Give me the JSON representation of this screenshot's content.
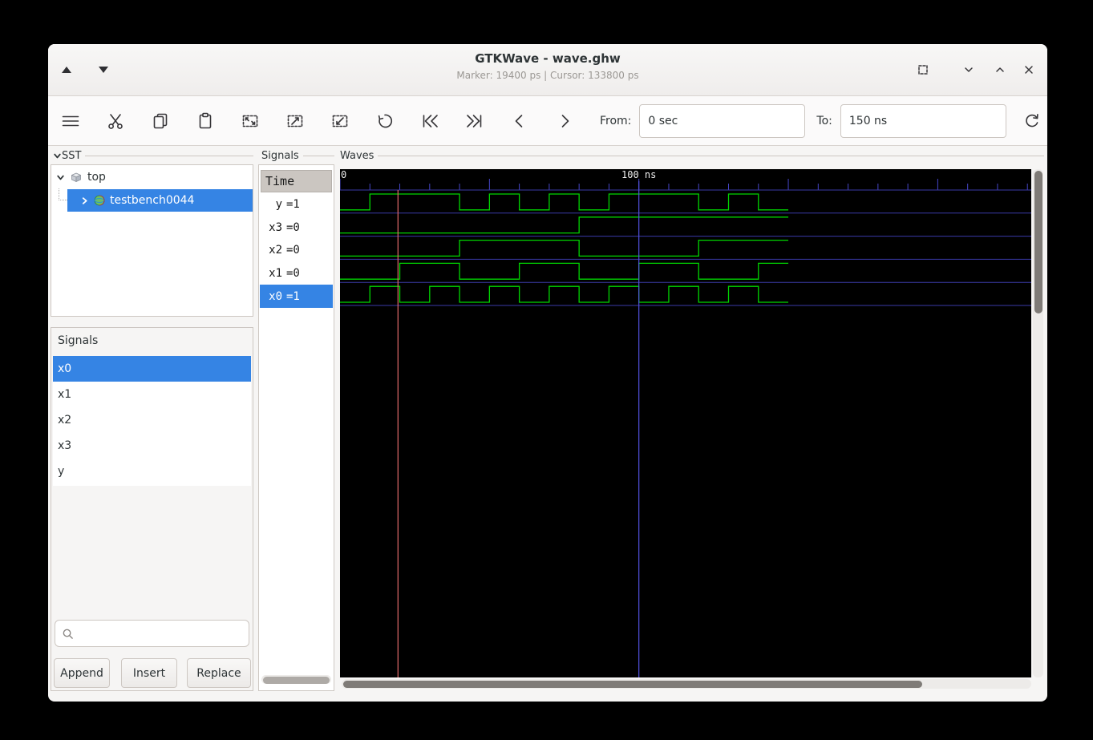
{
  "window": {
    "title": "GTKWave - wave.ghw",
    "subtitle": "Marker: 19400 ps | Cursor: 133800 ps",
    "marker": "19400 ps",
    "cursor": "133800 ps"
  },
  "toolbar": {
    "from_label": "From:",
    "from_value": "0 sec",
    "to_label": "To:",
    "to_value": "150 ns",
    "icon_names": [
      "menu-icon",
      "cut-icon",
      "copy-icon",
      "paste-icon",
      "zoom-fit-icon",
      "zoom-in-icon",
      "zoom-out-icon",
      "undo-icon",
      "to-start-icon",
      "to-end-icon",
      "left-icon",
      "right-icon",
      "reload-icon"
    ]
  },
  "sst": {
    "frame_label": "SST",
    "tree": [
      {
        "label": "top",
        "expanded": true
      },
      {
        "label": "testbench0044",
        "selected": true
      }
    ]
  },
  "signal_list": {
    "frame_label": "Signals",
    "items": [
      {
        "label": "x0",
        "selected": true
      },
      {
        "label": "x1"
      },
      {
        "label": "x2"
      },
      {
        "label": "x3"
      },
      {
        "label": "y"
      }
    ],
    "search_value": "",
    "buttons": {
      "append": "Append",
      "insert": "Insert",
      "replace": "Replace"
    }
  },
  "signals_panel": {
    "frame_label": "Signals",
    "time_header": "Time",
    "rows": [
      {
        "name": "y",
        "value": "=1"
      },
      {
        "name": "x3",
        "value": "=0"
      },
      {
        "name": "x2",
        "value": "=0"
      },
      {
        "name": "x1",
        "value": "=0"
      },
      {
        "name": "x0",
        "value": "=1",
        "selected": true
      }
    ]
  },
  "waves": {
    "frame_label": "Waves"
  },
  "chart_data": {
    "type": "digital-waveform",
    "time_unit": "ns",
    "t_start": 0,
    "t_end": 150,
    "tick_interval_ns": 10,
    "timeline_labels": [
      {
        "t": 0,
        "label": "0"
      },
      {
        "t": 100,
        "label": "100 ns"
      }
    ],
    "marker_ns": 19.4,
    "grid_line_ns": 100,
    "signals": [
      {
        "name": "y",
        "transitions": [
          [
            0,
            0
          ],
          [
            10,
            1
          ],
          [
            40,
            0
          ],
          [
            50,
            1
          ],
          [
            60,
            0
          ],
          [
            70,
            1
          ],
          [
            80,
            0
          ],
          [
            90,
            1
          ],
          [
            120,
            0
          ],
          [
            130,
            1
          ],
          [
            140,
            0
          ]
        ]
      },
      {
        "name": "x3",
        "transitions": [
          [
            0,
            0
          ],
          [
            80,
            1
          ]
        ]
      },
      {
        "name": "x2",
        "transitions": [
          [
            0,
            0
          ],
          [
            40,
            1
          ],
          [
            80,
            0
          ],
          [
            120,
            1
          ]
        ]
      },
      {
        "name": "x1",
        "transitions": [
          [
            0,
            0
          ],
          [
            20,
            1
          ],
          [
            40,
            0
          ],
          [
            60,
            1
          ],
          [
            80,
            0
          ],
          [
            100,
            1
          ],
          [
            120,
            0
          ],
          [
            140,
            1
          ]
        ]
      },
      {
        "name": "x0",
        "transitions": [
          [
            0,
            0
          ],
          [
            10,
            1
          ],
          [
            20,
            0
          ],
          [
            30,
            1
          ],
          [
            40,
            0
          ],
          [
            50,
            1
          ],
          [
            60,
            0
          ],
          [
            70,
            1
          ],
          [
            80,
            0
          ],
          [
            90,
            1
          ],
          [
            100,
            0
          ],
          [
            110,
            1
          ],
          [
            120,
            0
          ],
          [
            130,
            1
          ],
          [
            140,
            0
          ]
        ]
      }
    ],
    "colors": {
      "wave": "#00d600",
      "separator": "#3a3aa8",
      "tick": "#4646c8",
      "grid": "#5252e0",
      "marker": "#e06a6a",
      "background": "#000000",
      "timeline_text": "#f0f0f0"
    }
  }
}
